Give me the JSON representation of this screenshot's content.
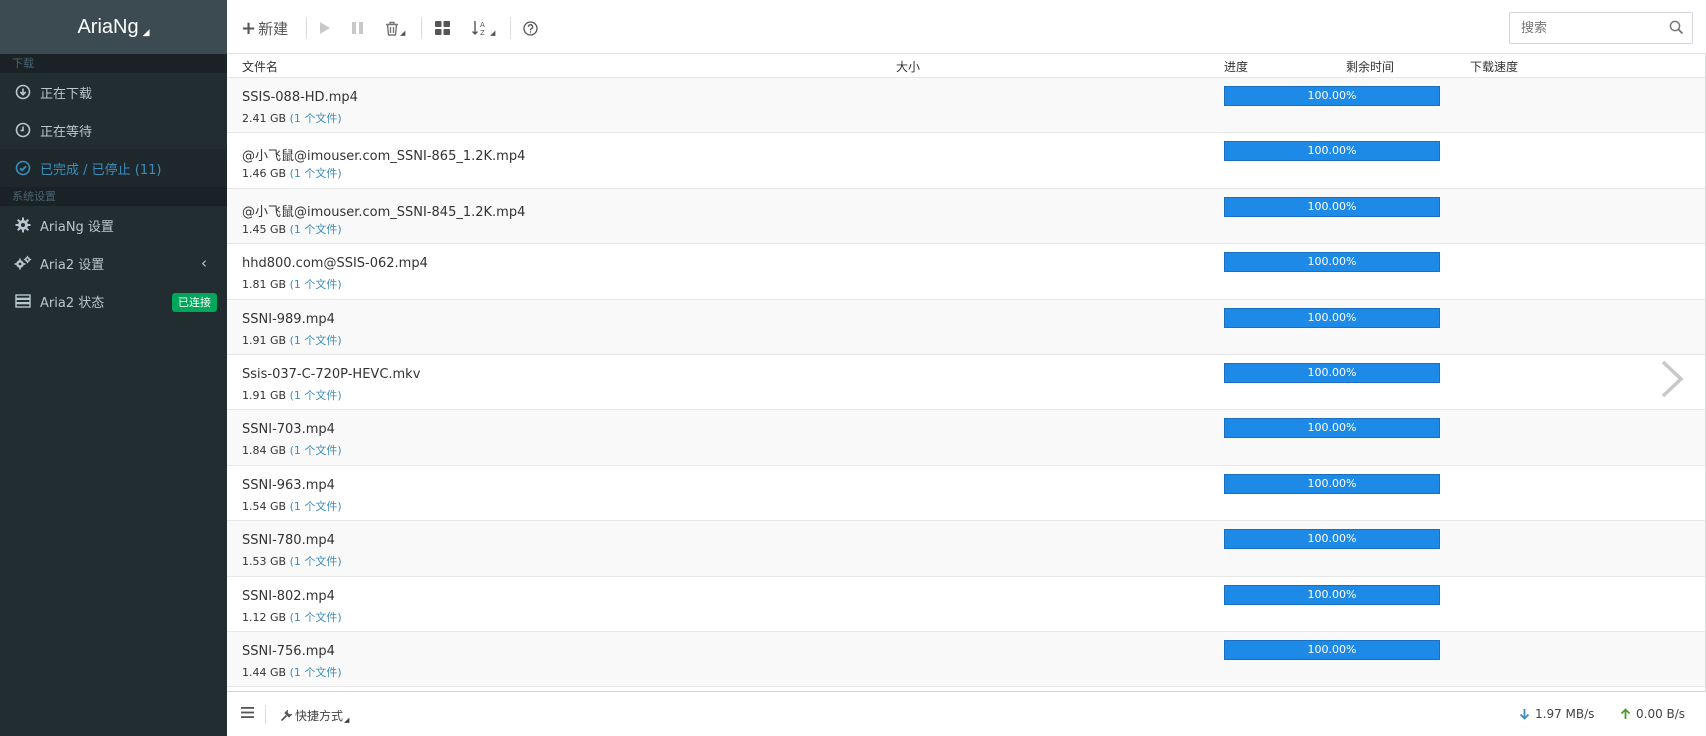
{
  "brand": {
    "title": "AriaNg"
  },
  "sidebar": {
    "section_download": "下载",
    "section_settings": "系统设置",
    "items": [
      {
        "label": "正在下载",
        "icon": "download-circle-icon"
      },
      {
        "label": "正在等待",
        "icon": "clock-icon"
      },
      {
        "label": "已完成 / 已停止 (11)",
        "icon": "check-circle-icon"
      },
      {
        "label": "AriaNg 设置",
        "icon": "gear-icon"
      },
      {
        "label": "Aria2 设置",
        "icon": "gears-icon"
      },
      {
        "label": "Aria2 状态",
        "icon": "server-icon",
        "badge": "已连接"
      }
    ]
  },
  "toolbar": {
    "new_label": "新建",
    "search_placeholder": "搜索"
  },
  "table": {
    "headers": {
      "name": "文件名",
      "size": "大小",
      "progress": "进度",
      "remaining": "剩余时间",
      "speed": "下载速度"
    },
    "rows": [
      {
        "name": "SSIS-088-HD.mp4",
        "size": "2.41 GB",
        "files": "(1 个文件)",
        "progress": "100.00%"
      },
      {
        "name": "@小飞鼠@imouser.com_SSNI-865_1.2K.mp4",
        "size": "1.46 GB",
        "files": "(1 个文件)",
        "progress": "100.00%"
      },
      {
        "name": "@小飞鼠@imouser.com_SSNI-845_1.2K.mp4",
        "size": "1.45 GB",
        "files": "(1 个文件)",
        "progress": "100.00%"
      },
      {
        "name": "hhd800.com@SSIS-062.mp4",
        "size": "1.81 GB",
        "files": "(1 个文件)",
        "progress": "100.00%"
      },
      {
        "name": "SSNI-989.mp4",
        "size": "1.91 GB",
        "files": "(1 个文件)",
        "progress": "100.00%"
      },
      {
        "name": "Ssis-037-C-720P-HEVC.mkv",
        "size": "1.91 GB",
        "files": "(1 个文件)",
        "progress": "100.00%"
      },
      {
        "name": "SSNI-703.mp4",
        "size": "1.84 GB",
        "files": "(1 个文件)",
        "progress": "100.00%"
      },
      {
        "name": "SSNI-963.mp4",
        "size": "1.54 GB",
        "files": "(1 个文件)",
        "progress": "100.00%"
      },
      {
        "name": "SSNI-780.mp4",
        "size": "1.53 GB",
        "files": "(1 个文件)",
        "progress": "100.00%"
      },
      {
        "name": "SSNI-802.mp4",
        "size": "1.12 GB",
        "files": "(1 个文件)",
        "progress": "100.00%"
      },
      {
        "name": "SSNI-756.mp4",
        "size": "1.44 GB",
        "files": "(1 个文件)",
        "progress": "100.00%"
      }
    ]
  },
  "statusbar": {
    "shortcut_label": "快捷方式",
    "download_speed": "1.97 MB/s",
    "upload_speed": "0.00 B/s"
  },
  "colors": {
    "accent": "#3c8dbc",
    "progress": "#1e8ae8",
    "badge": "#00a65a",
    "sidebar": "#222d32"
  }
}
